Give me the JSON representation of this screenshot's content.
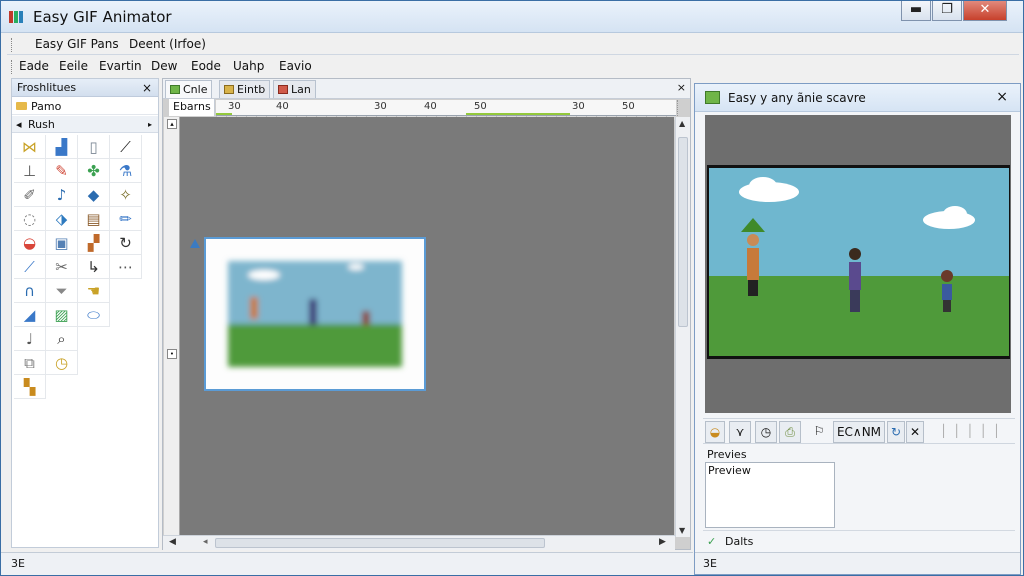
{
  "window": {
    "title": "Easy GIF Animator",
    "controls": {
      "minimize": "▬",
      "maximize": "❐",
      "close": "✕"
    }
  },
  "toolbar_top": {
    "item1": "Easy GIF Pans",
    "item2": "Deent (Irfoe)"
  },
  "menu": [
    "Eade",
    "Eeile",
    "Evartin",
    "Dew",
    "Eode",
    "Uahp",
    "Eavio"
  ],
  "tool_panel": {
    "title": "Froshlitues",
    "close": "×",
    "pane_label": "Pamo",
    "brush_label": "Rush",
    "brush_toggle": "◂"
  },
  "document": {
    "tabs": [
      "Cnle",
      "Eintb",
      "Lan"
    ],
    "pin": "×",
    "frames_label": "Ebarns",
    "ruler_ticks": [
      "30",
      "40",
      "30",
      "40",
      "50",
      "30",
      "50"
    ]
  },
  "preview": {
    "title": "Easy y any ãnie scavre",
    "close": "×",
    "controls_text": "EC∧NM",
    "label": "Previes",
    "box_text": "Preview",
    "details": "Dalts"
  },
  "status": {
    "left": "3E",
    "right": "3E"
  },
  "colors": {
    "accent": "#5b9bd5",
    "sky": "#6fb7cf",
    "grass": "#4f9a3a"
  }
}
